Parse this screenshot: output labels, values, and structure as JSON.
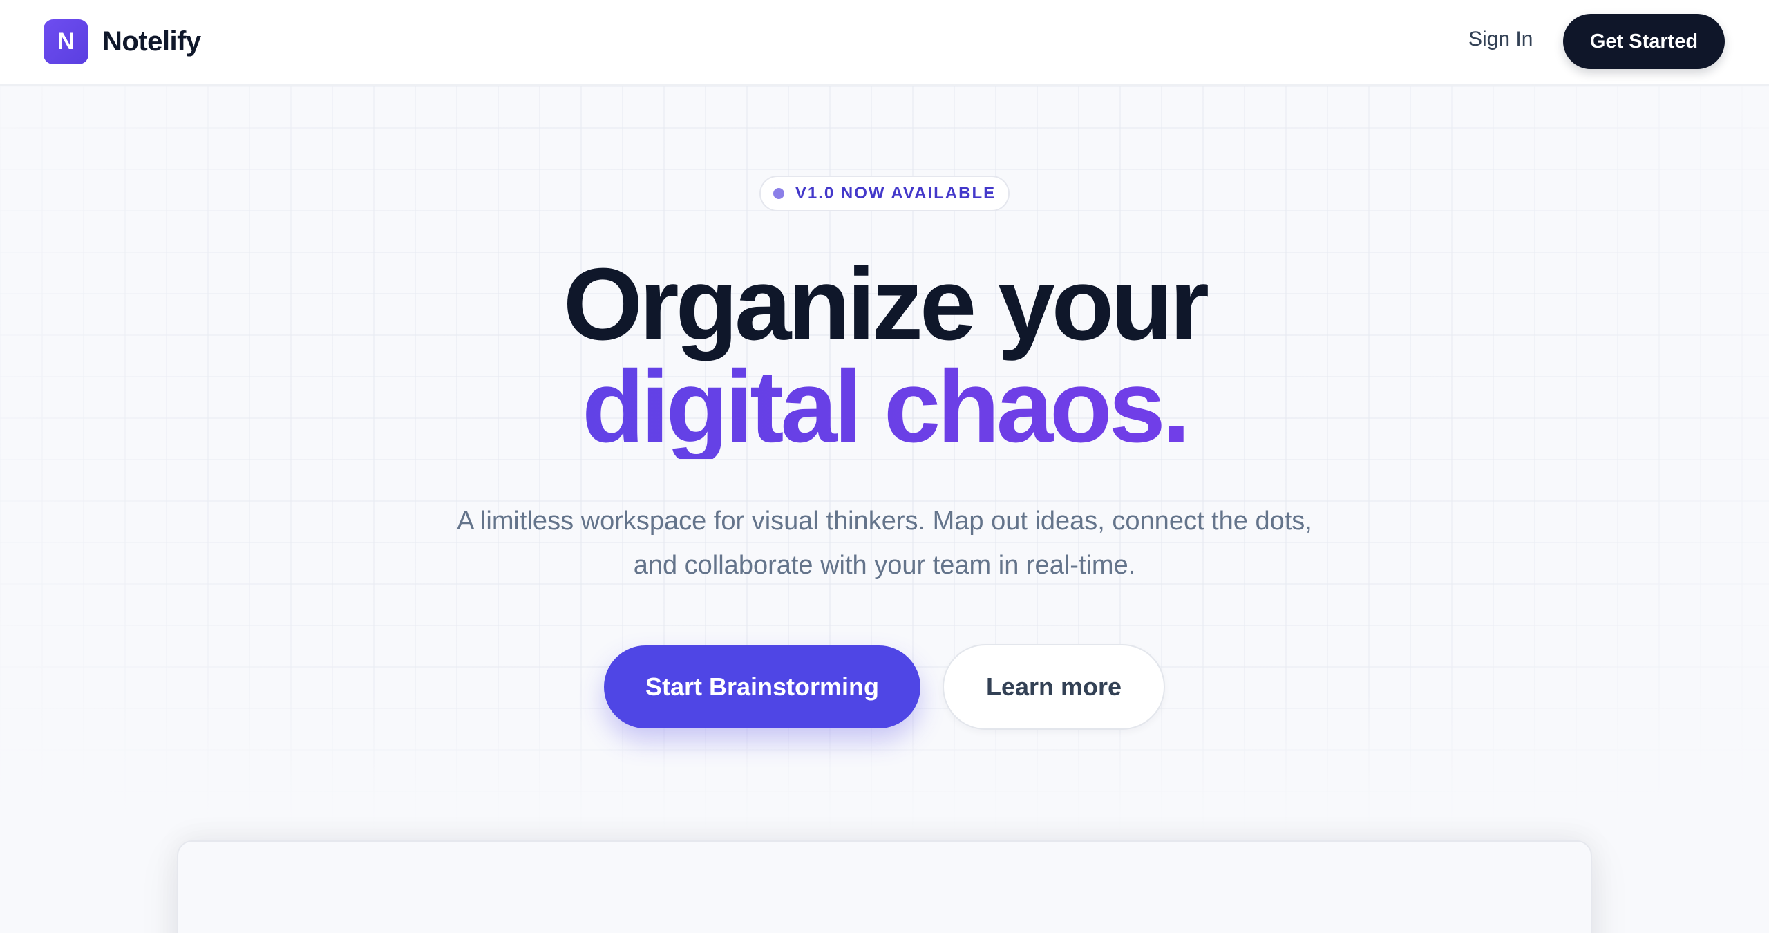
{
  "header": {
    "logo_letter": "N",
    "brand_name": "Notelify",
    "sign_in_label": "Sign In",
    "get_started_label": "Get Started"
  },
  "hero": {
    "badge_text": "V1.0 NOW AVAILABLE",
    "headline_line1": "Organize your",
    "headline_line2": "digital chaos.",
    "subtitle_line1": "A limitless workspace for visual thinkers. Map out ideas, connect the dots,",
    "subtitle_line2": "and collaborate with your team in real-time.",
    "primary_cta_label": "Start Brainstorming",
    "secondary_cta_label": "Learn more"
  },
  "colors": {
    "accent": "#4f46e5",
    "accent_purple": "#7c3aed",
    "dark": "#0f172a",
    "muted_text": "#64748b",
    "badge_dot": "#8b7fe8"
  }
}
